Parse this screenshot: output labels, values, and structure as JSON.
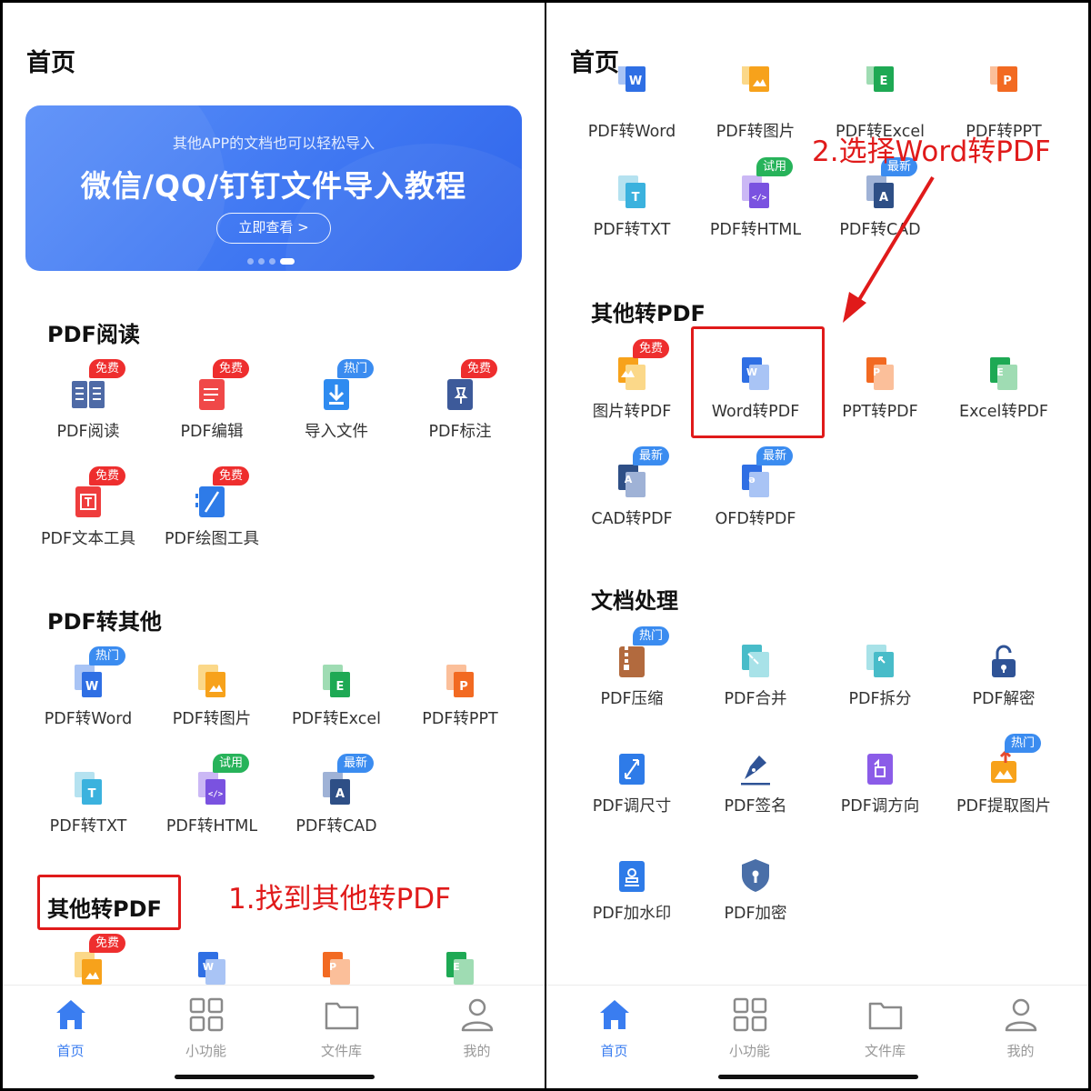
{
  "colors": {
    "accent": "#3a7df0",
    "annotation": "#e01a1a",
    "badge_red": "#ee2e2e",
    "badge_blue": "#3b8cf0",
    "badge_green": "#27b35a"
  },
  "left": {
    "page_title": "首页",
    "banner": {
      "subtitle": "其他APP的文档也可以轻松导入",
      "title": "微信/QQ/钉钉文件导入教程",
      "button": "立即查看 >"
    },
    "sections": {
      "pdf_read": {
        "title": "PDF阅读",
        "items": [
          {
            "label": "PDF阅读",
            "badge": "免费",
            "icon": "book-icon"
          },
          {
            "label": "PDF编辑",
            "badge": "免费",
            "icon": "edit-doc-icon"
          },
          {
            "label": "导入文件",
            "badge": "热门",
            "icon": "import-icon"
          },
          {
            "label": "PDF标注",
            "badge": "免费",
            "icon": "pin-icon"
          },
          {
            "label": "PDF文本工具",
            "badge": "免费",
            "icon": "text-tool-icon"
          },
          {
            "label": "PDF绘图工具",
            "badge": "免费",
            "icon": "draw-tool-icon"
          }
        ]
      },
      "pdf_to_other": {
        "title": "PDF转其他",
        "items": [
          {
            "label": "PDF转Word",
            "badge": "热门",
            "icon": "word-icon"
          },
          {
            "label": "PDF转图片",
            "badge": "",
            "icon": "image-icon"
          },
          {
            "label": "PDF转Excel",
            "badge": "",
            "icon": "excel-icon"
          },
          {
            "label": "PDF转PPT",
            "badge": "",
            "icon": "ppt-icon"
          },
          {
            "label": "PDF转TXT",
            "badge": "",
            "icon": "txt-icon"
          },
          {
            "label": "PDF转HTML",
            "badge": "试用",
            "icon": "html-icon"
          },
          {
            "label": "PDF转CAD",
            "badge": "最新",
            "icon": "cad-icon"
          }
        ]
      },
      "other_to_pdf": {
        "title": "其他转PDF",
        "items": [
          {
            "badge": "免费",
            "icon": "image-icon"
          },
          {
            "badge": "",
            "icon": "word-icon"
          },
          {
            "badge": "",
            "icon": "ppt-icon"
          },
          {
            "badge": "",
            "icon": "excel-icon"
          }
        ]
      }
    },
    "annotation": "1.找到其他转PDF"
  },
  "right": {
    "page_title": "首页",
    "top_rows": {
      "row1": [
        {
          "label": "PDF转Word",
          "icon": "word-icon"
        },
        {
          "label": "PDF转图片",
          "icon": "image-icon"
        },
        {
          "label": "PDF转Excel",
          "icon": "excel-icon"
        },
        {
          "label": "PDF转PPT",
          "icon": "ppt-icon"
        }
      ],
      "row2": [
        {
          "label": "PDF转TXT",
          "badge": "",
          "icon": "txt-icon"
        },
        {
          "label": "PDF转HTML",
          "badge": "试用",
          "icon": "html-icon"
        },
        {
          "label": "PDF转CAD",
          "badge": "最新",
          "icon": "cad-icon"
        }
      ]
    },
    "other_to_pdf": {
      "title": "其他转PDF",
      "items": [
        {
          "label": "图片转PDF",
          "badge": "免费",
          "icon": "image-icon"
        },
        {
          "label": "Word转PDF",
          "badge": "",
          "icon": "word-icon"
        },
        {
          "label": "PPT转PDF",
          "badge": "",
          "icon": "ppt-icon"
        },
        {
          "label": "Excel转PDF",
          "badge": "",
          "icon": "excel-icon"
        },
        {
          "label": "CAD转PDF",
          "badge": "最新",
          "icon": "cad-icon"
        },
        {
          "label": "OFD转PDF",
          "badge": "最新",
          "icon": "ofd-icon"
        }
      ]
    },
    "doc_process": {
      "title": "文档处理",
      "items": [
        {
          "label": "PDF压缩",
          "badge": "热门",
          "icon": "compress-icon"
        },
        {
          "label": "PDF合并",
          "badge": "",
          "icon": "merge-icon"
        },
        {
          "label": "PDF拆分",
          "badge": "",
          "icon": "split-icon"
        },
        {
          "label": "PDF解密",
          "badge": "",
          "icon": "unlock-icon"
        },
        {
          "label": "PDF调尺寸",
          "badge": "",
          "icon": "resize-icon"
        },
        {
          "label": "PDF签名",
          "badge": "",
          "icon": "signature-icon"
        },
        {
          "label": "PDF调方向",
          "badge": "",
          "icon": "rotate-icon"
        },
        {
          "label": "PDF提取图片",
          "badge": "热门",
          "icon": "extract-image-icon"
        },
        {
          "label": "PDF加水印",
          "badge": "",
          "icon": "watermark-icon"
        },
        {
          "label": "PDF加密",
          "badge": "",
          "icon": "lock-shield-icon"
        }
      ]
    },
    "annotation": "2.选择Word转PDF"
  },
  "nav": [
    {
      "label": "首页",
      "icon": "home-icon"
    },
    {
      "label": "小功能",
      "icon": "grid-icon"
    },
    {
      "label": "文件库",
      "icon": "folder-icon"
    },
    {
      "label": "我的",
      "icon": "user-icon"
    }
  ]
}
